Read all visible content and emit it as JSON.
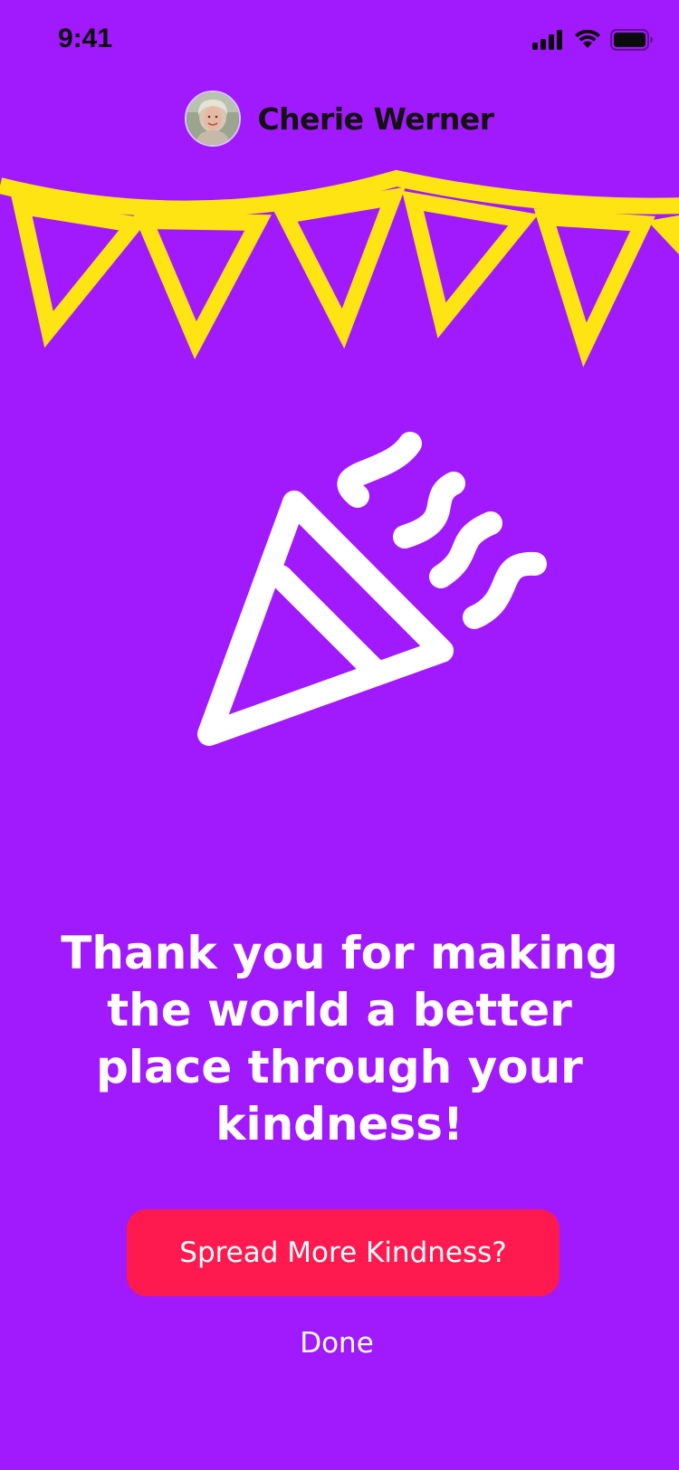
{
  "status_bar": {
    "time": "9:41",
    "icons": [
      "cellular-signal-icon",
      "wifi-icon",
      "battery-icon"
    ]
  },
  "header": {
    "user_name": "Cherie Werner",
    "avatar": "profile-photo"
  },
  "illustrations": {
    "bunting": "bunting-banner",
    "popper": "party-popper-icon"
  },
  "message": {
    "text": "Thank you for making the world a better place through your kindness!"
  },
  "actions": {
    "primary_label": "Spread More Kindness?",
    "secondary_label": "Done"
  },
  "colors": {
    "background": "#a119fd",
    "bunting": "#ffe413",
    "primary_button": "#fe1a4f",
    "text": "#ffffff"
  }
}
